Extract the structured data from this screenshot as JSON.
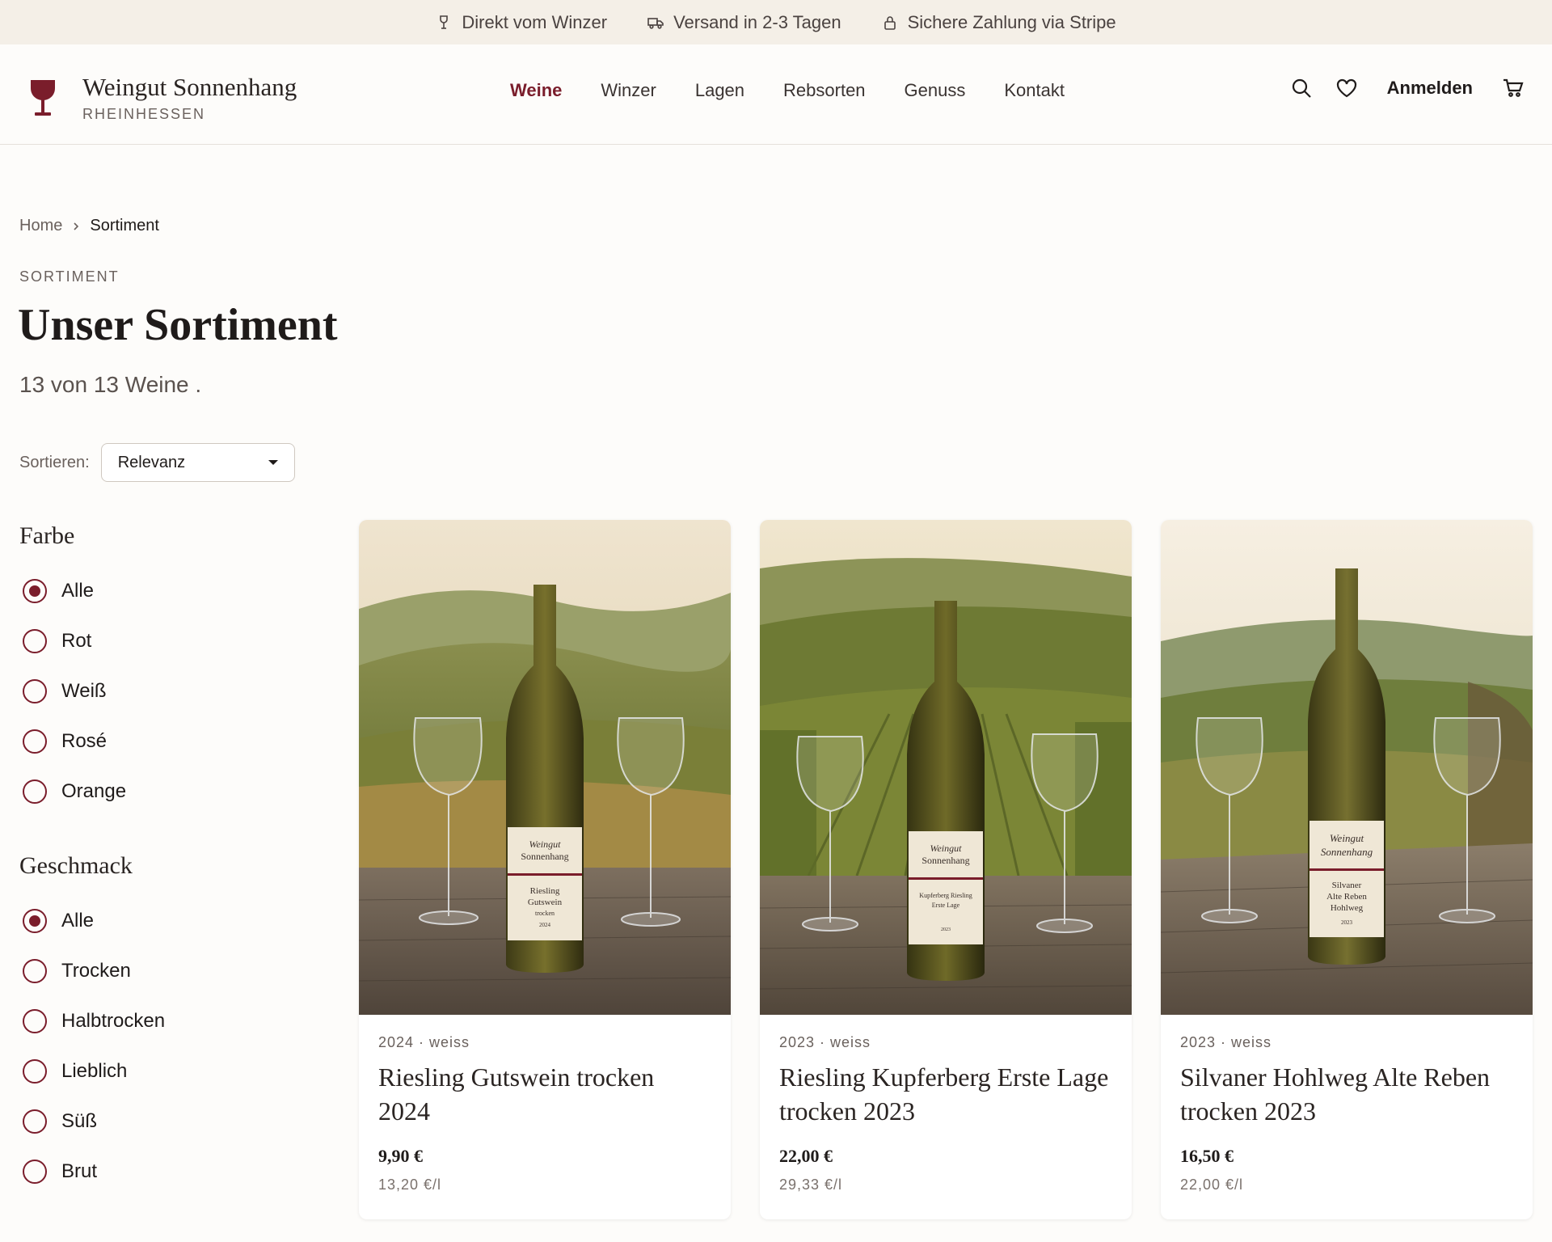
{
  "topbar": {
    "items": [
      {
        "icon": "wine-glass-icon",
        "label": "Direkt vom Winzer"
      },
      {
        "icon": "truck-icon",
        "label": "Versand in 2-3 Tagen"
      },
      {
        "icon": "lock-icon",
        "label": "Sichere Zahlung via Stripe"
      }
    ]
  },
  "header": {
    "brand": "Weingut Sonnenhang",
    "region": "RHEINHESSEN",
    "nav": [
      "Weine",
      "Winzer",
      "Lagen",
      "Rebsorten",
      "Genuss",
      "Kontakt"
    ],
    "active_nav": "Weine",
    "login": "Anmelden",
    "accent_color": "#7a1d2b"
  },
  "breadcrumb": {
    "home": "Home",
    "current": "Sortiment"
  },
  "page": {
    "eyebrow": "SORTIMENT",
    "title": "Unser Sortiment",
    "count": "13 von 13 Weine ."
  },
  "sort": {
    "label": "Sortieren:",
    "value": "Relevanz"
  },
  "filters": {
    "farbe": {
      "title": "Farbe",
      "options": [
        "Alle",
        "Rot",
        "Weiß",
        "Rosé",
        "Orange"
      ],
      "selected": "Alle"
    },
    "geschmack": {
      "title": "Geschmack",
      "options": [
        "Alle",
        "Trocken",
        "Halbtrocken",
        "Lieblich",
        "Süß",
        "Brut"
      ],
      "selected": "Alle"
    }
  },
  "products": [
    {
      "meta": "2024 · weiss",
      "name": "Riesling Gutswein trocken 2024",
      "price": "9,90 €",
      "unit_price": "13,20 €/l",
      "label_lines": [
        "Weingut",
        "Sonnenhang",
        "Riesling",
        "Gutswein",
        "trocken",
        "2024"
      ]
    },
    {
      "meta": "2023 · weiss",
      "name": "Riesling Kupferberg Erste Lage trocken 2023",
      "price": "22,00 €",
      "unit_price": "29,33 €/l",
      "label_lines": [
        "Weingut",
        "Sonnenhang",
        "Kupferberg Riesling",
        "Erste Lage",
        "",
        "2023"
      ]
    },
    {
      "meta": "2023 · weiss",
      "name": "Silvaner Hohlweg Alte Reben trocken 2023",
      "price": "16,50 €",
      "unit_price": "22,00 €/l",
      "label_lines": [
        "Weingut",
        "Sonnenhang",
        "Silvaner",
        "Alte Reben",
        "Hohlweg",
        "2023"
      ]
    }
  ]
}
